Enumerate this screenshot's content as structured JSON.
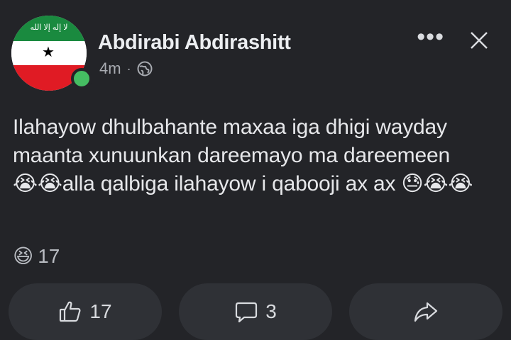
{
  "post": {
    "author_name": "Abdirabi Abdirashitt",
    "time": "4m",
    "separator": "·",
    "privacy_icon": "globe-icon",
    "text": "Ilahayow dhulbahante maxaa iga dhigi wayday maanta xunuunkan dareemayo ma dareemeen 😭😭alla qalbiga ilahayow i qabooji ax ax 😓😭😭"
  },
  "avatar": {
    "script": "لا إله إلا الله",
    "star": "★"
  },
  "header": {
    "more_label": "•••",
    "close_icon": "close-icon"
  },
  "reactions": {
    "emoji": "😆",
    "count": "17"
  },
  "actions": {
    "like": {
      "icon": "thumbs-up-icon",
      "count": "17"
    },
    "comment": {
      "icon": "comment-icon",
      "count": "3"
    },
    "share": {
      "icon": "share-icon"
    }
  },
  "colors": {
    "background": "#232428",
    "button_bg": "#2f3136",
    "online": "#45bd62"
  }
}
